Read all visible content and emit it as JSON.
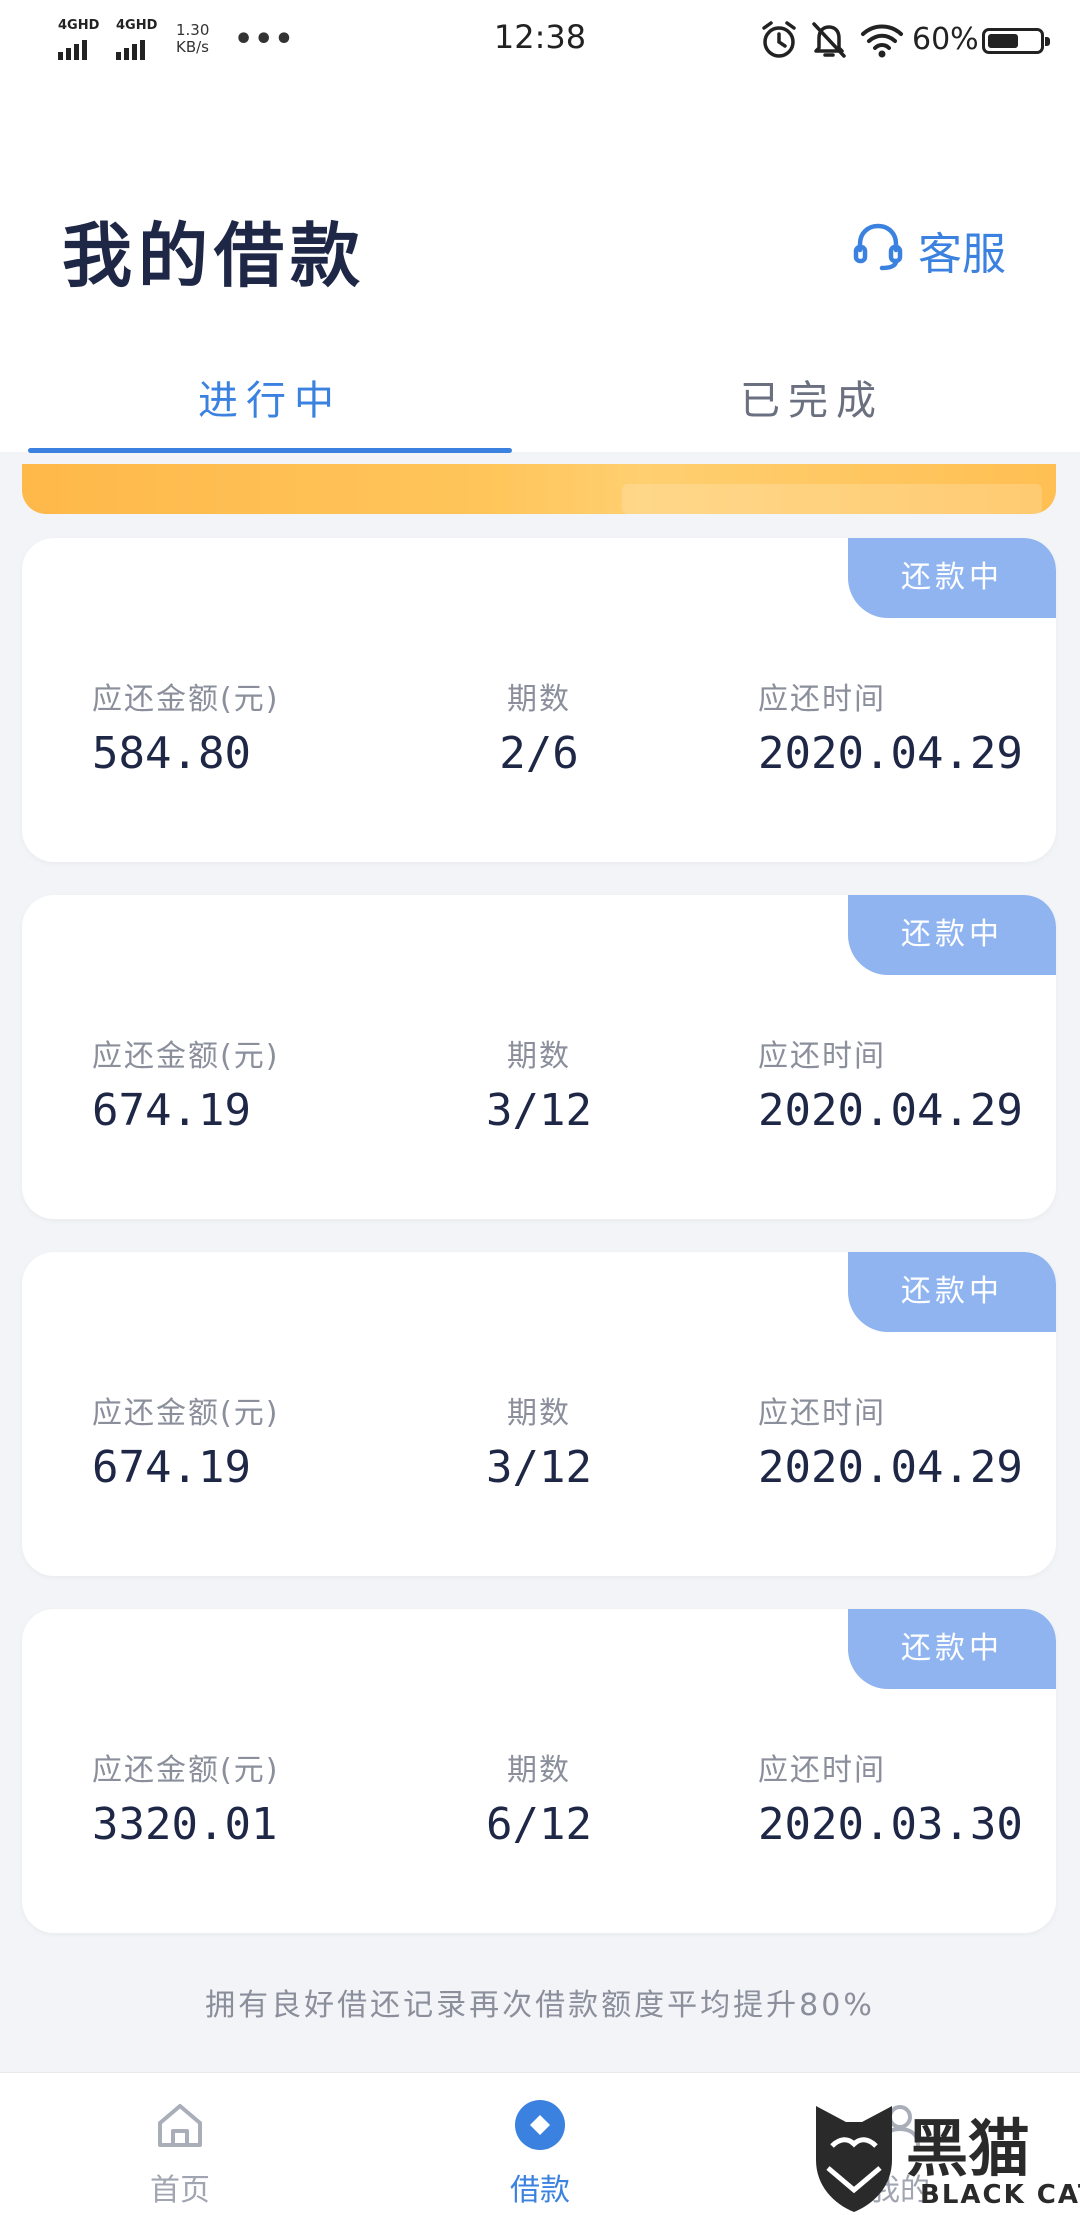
{
  "status_bar": {
    "signal1_label": "4GHD",
    "signal2_label": "4GHD",
    "net_speed_value": "1.30",
    "net_speed_unit": "KB/s",
    "more": "•••",
    "time": "12:38",
    "battery_text": "60%",
    "battery_level": 0.6
  },
  "header": {
    "title": "我的借款",
    "service_label": "客服"
  },
  "tabs": [
    {
      "label": "进行中",
      "active": true
    },
    {
      "label": "已完成",
      "active": false
    }
  ],
  "loans": [
    {
      "badge": "还款中",
      "amount_label": "应还金额(元)",
      "amount": "584.80",
      "period_label": "期数",
      "period": "2/6",
      "date_label": "应还时间",
      "date": "2020.04.29"
    },
    {
      "badge": "还款中",
      "amount_label": "应还金额(元)",
      "amount": "674.19",
      "period_label": "期数",
      "period": "3/12",
      "date_label": "应还时间",
      "date": "2020.04.29"
    },
    {
      "badge": "还款中",
      "amount_label": "应还金额(元)",
      "amount": "674.19",
      "period_label": "期数",
      "period": "3/12",
      "date_label": "应还时间",
      "date": "2020.04.29"
    },
    {
      "badge": "还款中",
      "amount_label": "应还金额(元)",
      "amount": "3320.01",
      "period_label": "期数",
      "period": "6/12",
      "date_label": "应还时间",
      "date": "2020.03.30"
    }
  ],
  "footer_note": "拥有良好借还记录再次借款额度平均提升80%",
  "bottom_nav": [
    {
      "label": "首页",
      "icon": "home-icon",
      "active": false
    },
    {
      "label": "借款",
      "icon": "loan-icon",
      "active": true
    },
    {
      "label": "我的",
      "icon": "profile-icon",
      "active": false
    }
  ],
  "watermark": {
    "text": "黑猫",
    "sub": "BLACK CAT"
  },
  "colors": {
    "accent": "#3b82e0",
    "badge": "#8fb4f0",
    "banner": "#ffc55a",
    "title": "#1f2747",
    "muted": "#8b8f9c"
  }
}
